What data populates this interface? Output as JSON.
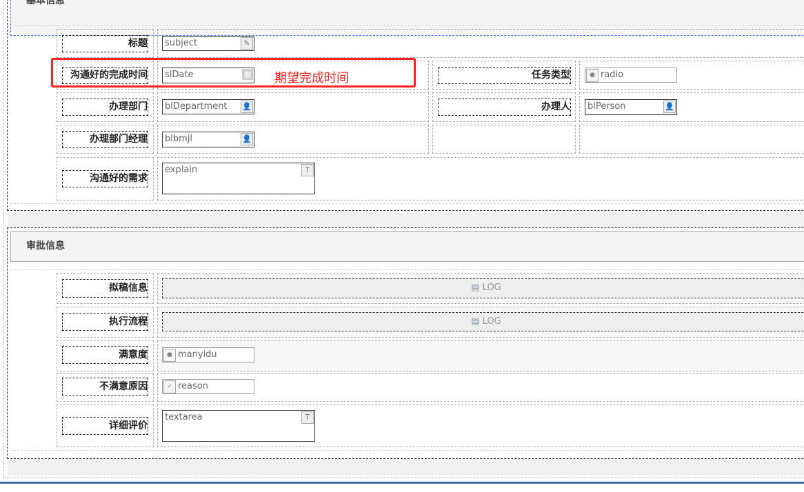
{
  "sections": [
    {
      "title": "基本信息"
    },
    {
      "title": "审批信息"
    }
  ],
  "basic": {
    "subject": {
      "label": "标题",
      "value": "subject"
    },
    "sldate": {
      "label": "沟通好的完成时间",
      "value": "slDate"
    },
    "task_type": {
      "label": "任务类型",
      "value": "radio"
    },
    "department": {
      "label": "办理部门",
      "value": "blDepartment"
    },
    "person": {
      "label": "办理人",
      "value": "blPerson"
    },
    "manager": {
      "label": "办理部门经理",
      "value": "blbmjl"
    },
    "explain": {
      "label": "沟通好的需求",
      "value": "explain"
    }
  },
  "annotation": {
    "text": "期望完成时间",
    "color": "#ff2222"
  },
  "approval": {
    "draft": {
      "label": "拟稿信息",
      "value": "LOG"
    },
    "flow": {
      "label": "执行流程",
      "value": "LOG"
    },
    "satisfaction": {
      "label": "满意度",
      "value": "manyidu"
    },
    "reason": {
      "label": "不满意原因",
      "value": "reason"
    },
    "detail": {
      "label": "详细评价",
      "value": "textarea"
    }
  }
}
